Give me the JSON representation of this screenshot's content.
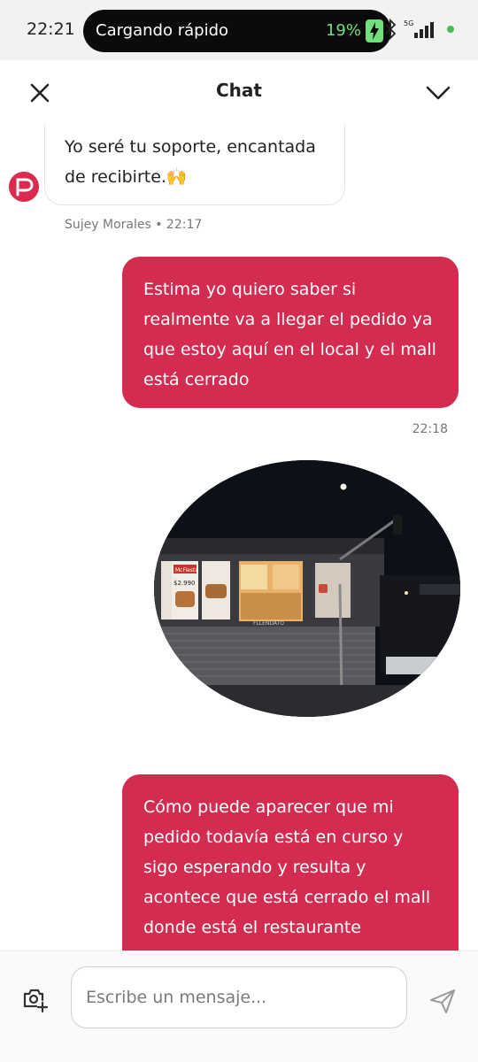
{
  "status_bar": {
    "time": "22:21",
    "charging_text": "Cargando rápido",
    "battery_pct": "19%",
    "network": "5G"
  },
  "header": {
    "title": "Chat"
  },
  "messages": {
    "incoming": {
      "text": "Yo seré tu soporte, encantada de recibirte.🙌",
      "sender": "Sujey Morales",
      "time": "22:17",
      "meta": "Sujey Morales • 22:17"
    },
    "outgoing_1": {
      "text": "Estima yo quiero saber si realmente va a llegar el pedido ya que estoy aquí en el local y el mall está cerrado",
      "time": "22:18"
    },
    "photo": {
      "promo_small": "McFiesta",
      "price": "$2.990",
      "storefront": "FLLENDATO"
    },
    "outgoing_2": {
      "text": "Cómo puede aparecer que mi pedido todavía está en curso y sigo esperando y resulta y acontece que está cerrado el mall donde está el restaurante"
    }
  },
  "composer": {
    "placeholder": "Escribe un mensaje..."
  },
  "colors": {
    "accent": "#d32c50",
    "status_bg": "#f2f2f2",
    "charging_green": "#6fe07a"
  }
}
